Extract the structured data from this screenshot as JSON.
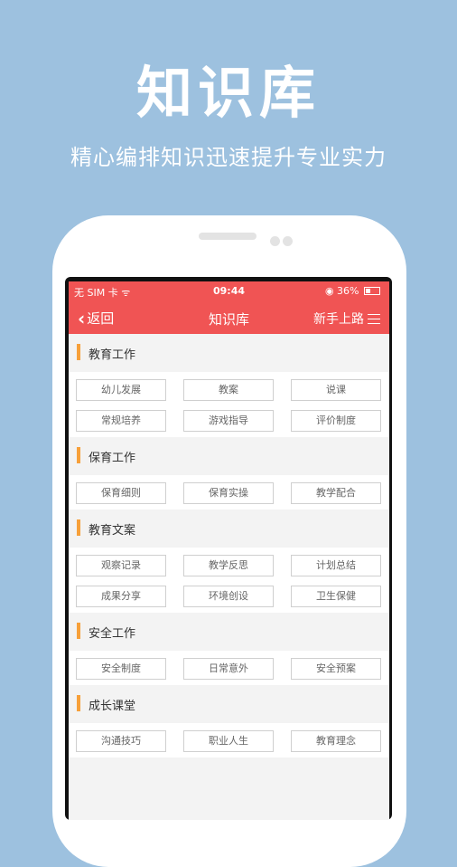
{
  "hero": {
    "title": "知识库",
    "subtitle": "精心编排知识迅速提升专业实力"
  },
  "statusbar": {
    "carrier": "无 SIM 卡",
    "time": "09:44",
    "battery": "36%"
  },
  "navbar": {
    "back_label": "返回",
    "title": "知识库",
    "right_label": "新手上路"
  },
  "sections": [
    {
      "title": "教育工作",
      "items": [
        [
          "幼儿发展",
          "教案",
          "说课"
        ],
        [
          "常规培养",
          "游戏指导",
          "评价制度"
        ]
      ]
    },
    {
      "title": "保育工作",
      "items": [
        [
          "保育细则",
          "保育实操",
          "教学配合"
        ]
      ]
    },
    {
      "title": "教育文案",
      "items": [
        [
          "观察记录",
          "教学反思",
          "计划总结"
        ],
        [
          "成果分享",
          "环境创设",
          "卫生保健"
        ]
      ]
    },
    {
      "title": "安全工作",
      "items": [
        [
          "安全制度",
          "日常意外",
          "安全预案"
        ]
      ]
    },
    {
      "title": "成长课堂",
      "items": [
        [
          "沟通技巧",
          "职业人生",
          "教育理念"
        ]
      ]
    }
  ],
  "colors": {
    "background": "#9dc1df",
    "accent": "#f05454",
    "section_marker": "#f7a03a"
  },
  "icons": [
    "wifi-icon",
    "alarm-icon",
    "battery-icon",
    "back-chevron-icon",
    "menu-icon"
  ]
}
